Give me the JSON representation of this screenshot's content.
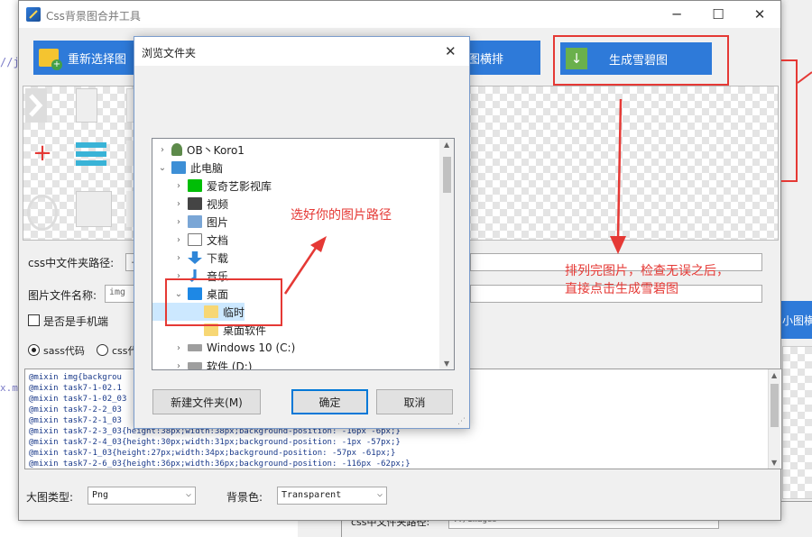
{
  "bg_app": {
    "tab_label": "小图横排",
    "css_path_label": "css中文件夹路径:",
    "css_path_value": "../images",
    "side_code_fragment": "//j",
    "side_code_fragment2": "x.m"
  },
  "main": {
    "title": "Css背景图合并工具",
    "reselect_label": "重新选择图",
    "arrange_label": "图横排",
    "generate_label": "生成雪碧图",
    "css_path_label": "css中文件夹路径:",
    "css_path_value": "..",
    "filename_label": "图片文件名称:",
    "filename_value": "img",
    "mobile_label": "是否是手机端",
    "sass_label": "sass代码",
    "css_label": "css代",
    "code_lines": [
      "@mixin img{backgrou",
      "@mixin task7-1-02.1",
      "@mixin task7-1-02_03",
      "@mixin task7-2-2_03",
      "@mixin task7-2-1_03",
      "@mixin task7-2-3_03{height:38px;width:38px;background-position: -16px -6px;}",
      "@mixin task7-2-4_03{height:30px;width:31px;background-position: -1px -57px;}",
      "@mixin task7-1_03{height:27px;width:34px;background-position: -57px -61px;}",
      "@mixin task7-2-6_03{height:36px;width:36px;background-position: -116px -62px;}"
    ],
    "format_label": "大图类型:",
    "format_value": "Png",
    "bgcolor_label": "背景色:",
    "bgcolor_value": "Transparent"
  },
  "dialog": {
    "title": "浏览文件夹",
    "tree": [
      {
        "label": "OB丶Koro1",
        "icon": "user-icon"
      },
      {
        "label": "此电脑",
        "icon": "computer-icon"
      },
      {
        "label": "爱奇艺影视库",
        "icon": "iqiyi-icon"
      },
      {
        "label": "视频",
        "icon": "video-icon"
      },
      {
        "label": "图片",
        "icon": "picture-icon"
      },
      {
        "label": "文档",
        "icon": "document-icon"
      },
      {
        "label": "下载",
        "icon": "download-icon"
      },
      {
        "label": "音乐",
        "icon": "music-icon"
      },
      {
        "label": "桌面",
        "icon": "desktop-icon"
      },
      {
        "label": "临时",
        "icon": "folder-icon"
      },
      {
        "label": "桌面软件",
        "icon": "folder-icon"
      },
      {
        "label": "Windows 10 (C:)",
        "icon": "drive-icon"
      },
      {
        "label": "软件 (D:)",
        "icon": "drive-icon"
      }
    ],
    "new_folder_label": "新建文件夹(M)",
    "ok_label": "确定",
    "cancel_label": "取消"
  },
  "annotations": {
    "select_path": "选好你的图片路径",
    "instruction_line1": "排列完图片，检查无误之后，",
    "instruction_line2": "直接点击生成雪碧图"
  },
  "colors": {
    "accent": "#2e7ad9",
    "annotation": "#e53935",
    "selection": "#cce8ff"
  }
}
